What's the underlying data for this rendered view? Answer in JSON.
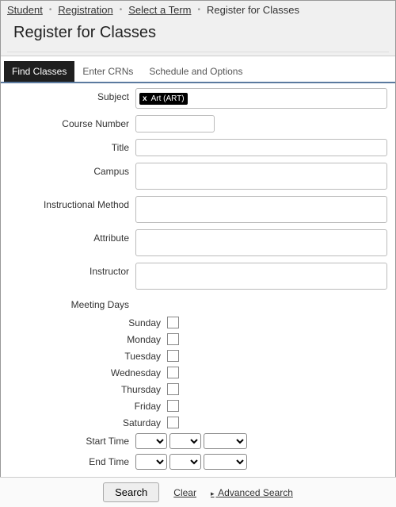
{
  "breadcrumb": {
    "items": [
      "Student",
      "Registration",
      "Select a Term"
    ],
    "current": "Register for Classes"
  },
  "page_title": "Register for Classes",
  "tabs": {
    "find": "Find Classes",
    "crns": "Enter CRNs",
    "sched": "Schedule and Options"
  },
  "form": {
    "subject_label": "Subject",
    "subject_tag": "Art (ART)",
    "subject_tag_x": "x",
    "course_number_label": "Course Number",
    "course_number_value": "",
    "title_label": "Title",
    "campus_label": "Campus",
    "instr_method_label": "Instructional Method",
    "attribute_label": "Attribute",
    "instructor_label": "Instructor",
    "meeting_days_label": "Meeting Days",
    "days": {
      "sun": "Sunday",
      "mon": "Monday",
      "tue": "Tuesday",
      "wed": "Wednesday",
      "thu": "Thursday",
      "fri": "Friday",
      "sat": "Saturday"
    },
    "start_time_label": "Start Time",
    "end_time_label": "End Time"
  },
  "footer": {
    "search": "Search",
    "clear": "Clear",
    "advanced": "Advanced Search",
    "caret": "▸"
  }
}
